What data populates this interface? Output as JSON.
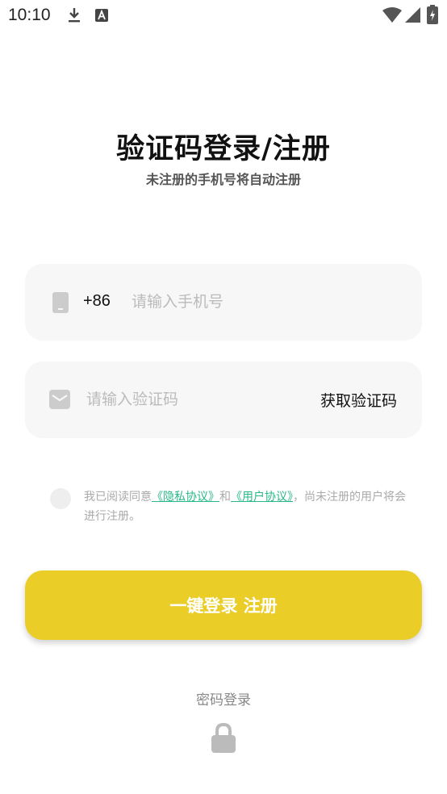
{
  "status_bar": {
    "time": "10:10",
    "icons": [
      "download-icon",
      "keyboard-a-icon",
      "wifi-icon",
      "signal-icon",
      "battery-charging-icon"
    ]
  },
  "header": {
    "title": "验证码登录/注册",
    "subtitle": "未注册的手机号将自动注册"
  },
  "phone_field": {
    "icon": "phone-icon",
    "prefix": "+86",
    "value": "",
    "placeholder": "请输入手机号"
  },
  "code_field": {
    "icon": "mail-icon",
    "value": "",
    "placeholder": "请输入验证码",
    "get_code_label": "获取验证码"
  },
  "agreement": {
    "checked": false,
    "text_before": "我已阅读同意",
    "privacy_link": "《隐私协议》",
    "text_and": "和",
    "user_link": "《用户协议》",
    "text_after": "，尚未注册的用户将会进行注册。"
  },
  "login_button": {
    "label": "一键登录 注册"
  },
  "password_login": {
    "label": "密码登录",
    "icon": "lock-icon"
  },
  "colors": {
    "accent": "#ebcd28",
    "link": "#28b88a",
    "field_bg": "#f7f7f7"
  }
}
